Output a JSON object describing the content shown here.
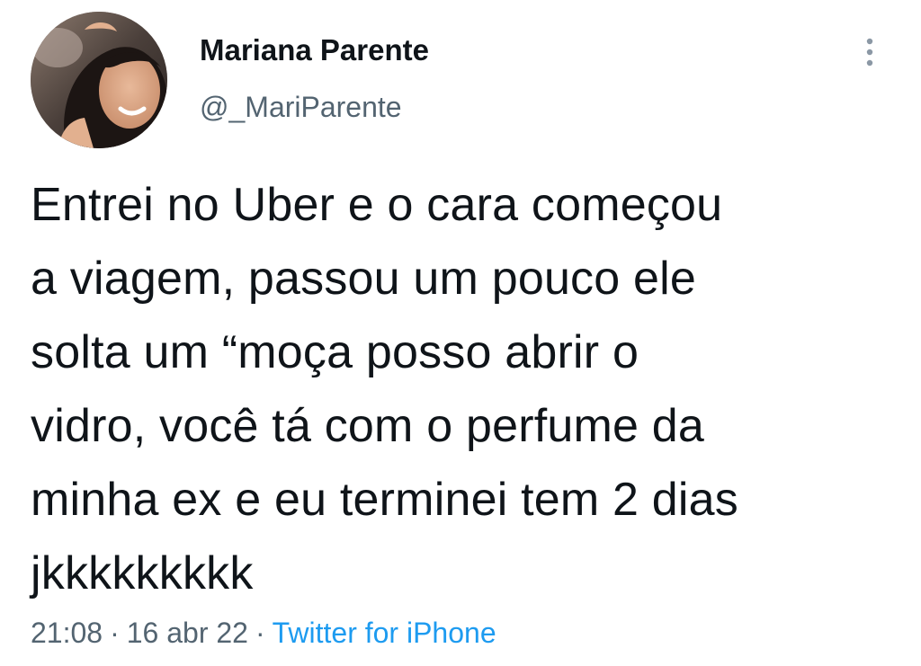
{
  "tweet": {
    "author": {
      "display_name": "Mariana Parente",
      "handle": "@_MariParente"
    },
    "text": "Entrei no Uber e o cara começou\na viagem, passou um pouco ele\nsolta um “moça posso abrir o\nvidro, você tá com o perfume da\nminha ex e eu terminei tem 2 dias\njkkkkkkkkk",
    "time": "21:08",
    "date": "16 abr 22",
    "separator": "·",
    "source": "Twitter for iPhone"
  },
  "icons": {
    "more": "more-vertical-icon",
    "avatar": "profile-photo"
  },
  "colors": {
    "text_primary": "#0f1419",
    "text_secondary": "#536471",
    "accent": "#1d9bf0",
    "background": "#ffffff"
  }
}
